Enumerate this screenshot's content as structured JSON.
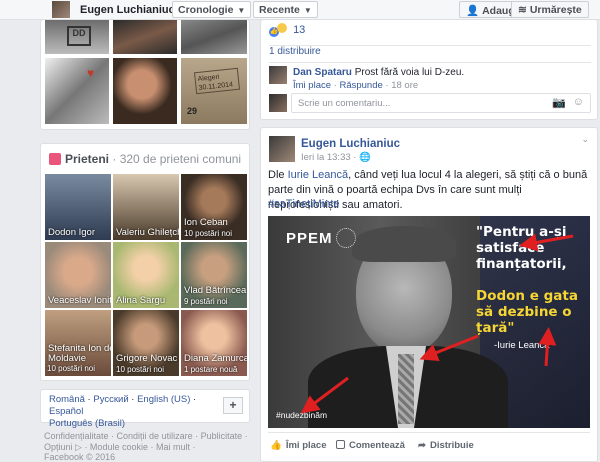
{
  "topbar": {
    "name": "Eugen Luchianiuc",
    "timeline_select": "Cronologie",
    "recent_select": "Recente",
    "add_button": "Adaugă",
    "follow_button": "Urmărește"
  },
  "photos": {
    "caption_date": "Alegeri 30.11.2014",
    "caption_num": "29"
  },
  "friends": {
    "title": "Prieteni",
    "count": "· 320 de prieteni comuni",
    "items": [
      {
        "name": "Dodon Igor",
        "sub": ""
      },
      {
        "name": "Valeriu Ghilețchi",
        "sub": ""
      },
      {
        "name": "Ion Ceban",
        "sub": "10 postări noi"
      },
      {
        "name": "Veaceslav Ioniță",
        "sub": ""
      },
      {
        "name": "Alina Sargu",
        "sub": ""
      },
      {
        "name": "Vlad Bătrîncea",
        "sub": "9 postări noi"
      },
      {
        "name": "Stefanita Ion de Moldavie",
        "sub": "10 postări noi"
      },
      {
        "name": "Grigore Novac",
        "sub": "10 postări noi"
      },
      {
        "name": "Diana Zamurca",
        "sub": "1 postare nouă"
      }
    ]
  },
  "languages": {
    "items": [
      "Română",
      "Русский",
      "English (US)",
      "Español",
      "Português (Brasil)"
    ],
    "add": "+"
  },
  "footer": {
    "line1": "Confidențialitate · Condiții de utilizare · Publicitate ·",
    "line2": "Opțiuni ▷ · Module cookie · Mai mult ·",
    "line3": "Facebook © 2016"
  },
  "prev_post": {
    "reaction_count": "13",
    "shares": "1 distribuire",
    "comment_author": "Dan Spataru",
    "comment_text": "Prost fără voia lui D-zeu.",
    "comment_like": "Îmi place",
    "comment_reply": "Răspunde",
    "comment_time": "· 18 ore",
    "comment_placeholder": "Scrie un comentariu..."
  },
  "post": {
    "author": "Eugen Luchianiuc",
    "time": "Ieri la 13:33 ·",
    "text_before": "Dle ",
    "mention": "Iurie Leancă",
    "text_after": ", când veți lua locul 4 la alegeri, să știți că o bună parte din vină o poartă echipa Dvs în care sunt mulți neprofesioniști sau amatori.",
    "hashtag": "#saȚinețiMinte",
    "image": {
      "brand": "PPEM",
      "quote_1": "\"Pentru a-și satisface finanțatorii,",
      "quote_2": "Dodon e gata să dezbine o țară\"",
      "quote_author": "-Iurie Leancă",
      "tag": "#nudezbinăm"
    },
    "actions": {
      "like": "Îmi place",
      "comment": "Comentează",
      "share": "Distribuie"
    }
  }
}
